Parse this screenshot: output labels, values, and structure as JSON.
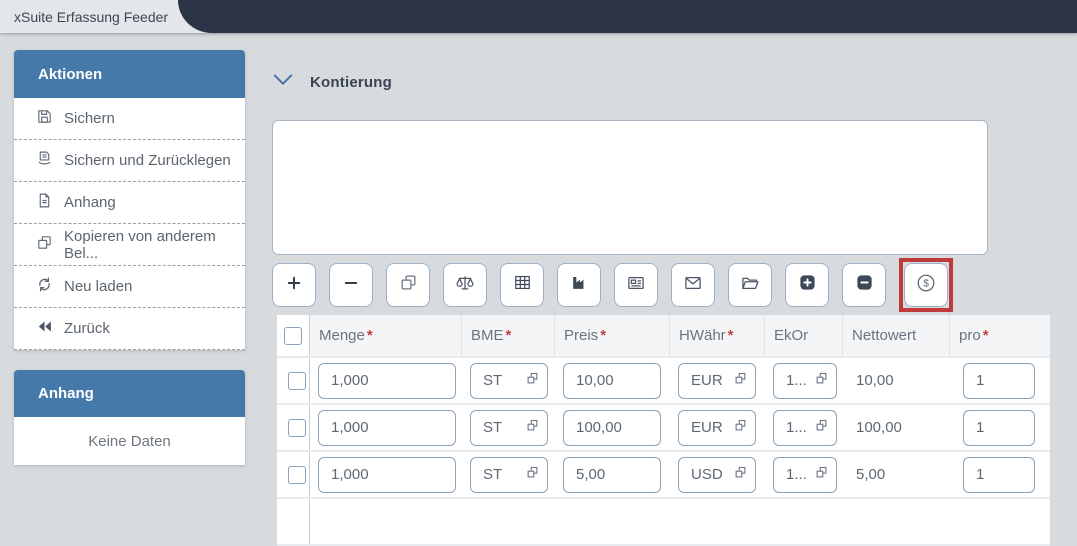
{
  "colors": {
    "topbar": "#2b3547",
    "accent_blue": "#4579aa",
    "highlight_red": "#bf3a3a",
    "page_bg": "#d7dbde"
  },
  "tab": {
    "title": "xSuite Erfassung Feeder"
  },
  "sidebar": {
    "actions_panel": {
      "title": "Aktionen",
      "items": [
        {
          "label": "Sichern",
          "icon": "save-icon"
        },
        {
          "label": "Sichern und Zurücklegen",
          "icon": "save-putback-icon"
        },
        {
          "label": "Anhang",
          "icon": "document-icon"
        },
        {
          "label": "Kopieren von anderem Bel...",
          "icon": "copy-icon"
        },
        {
          "label": "Neu laden",
          "icon": "reload-icon"
        },
        {
          "label": "Zurück",
          "icon": "back-icon"
        }
      ]
    },
    "attachment_panel": {
      "title": "Anhang",
      "empty_text": "Keine Daten"
    }
  },
  "main": {
    "section_title": "Kontierung",
    "toolbar": {
      "buttons": [
        {
          "name": "add-row",
          "icon": "plus-icon"
        },
        {
          "name": "remove-row",
          "icon": "minus-icon"
        },
        {
          "name": "copy-row",
          "icon": "copy-icon"
        },
        {
          "name": "balance",
          "icon": "scales-icon"
        },
        {
          "name": "table-view",
          "icon": "grid-icon"
        },
        {
          "name": "factory",
          "icon": "factory-icon"
        },
        {
          "name": "news",
          "icon": "newspaper-icon"
        },
        {
          "name": "mail",
          "icon": "envelope-icon"
        },
        {
          "name": "open-folder",
          "icon": "folder-open-icon"
        },
        {
          "name": "add-filled",
          "icon": "plus-square-icon"
        },
        {
          "name": "remove-filled",
          "icon": "minus-square-icon"
        },
        {
          "name": "currency",
          "icon": "dollar-circle-icon",
          "highlighted": true
        }
      ],
      "dollar_glyph": "$"
    },
    "table": {
      "columns": [
        {
          "label": "Menge",
          "required": true
        },
        {
          "label": "BME",
          "required": true
        },
        {
          "label": "Preis",
          "required": true
        },
        {
          "label": "HWähr",
          "required": true
        },
        {
          "label": "EkOr",
          "required": false
        },
        {
          "label": "Nettowert",
          "required": false
        },
        {
          "label": "pro",
          "required": true
        }
      ],
      "required_marker": "*",
      "rows": [
        {
          "menge": "1,000",
          "bme": "ST",
          "preis": "10,00",
          "hwaehr": "EUR",
          "ekor": "1...",
          "nettowert": "10,00",
          "pro": "1"
        },
        {
          "menge": "1,000",
          "bme": "ST",
          "preis": "100,00",
          "hwaehr": "EUR",
          "ekor": "1...",
          "nettowert": "100,00",
          "pro": "1"
        },
        {
          "menge": "1,000",
          "bme": "ST",
          "preis": "5,00",
          "hwaehr": "USD",
          "ekor": "1...",
          "nettowert": "5,00",
          "pro": "1"
        }
      ]
    }
  }
}
